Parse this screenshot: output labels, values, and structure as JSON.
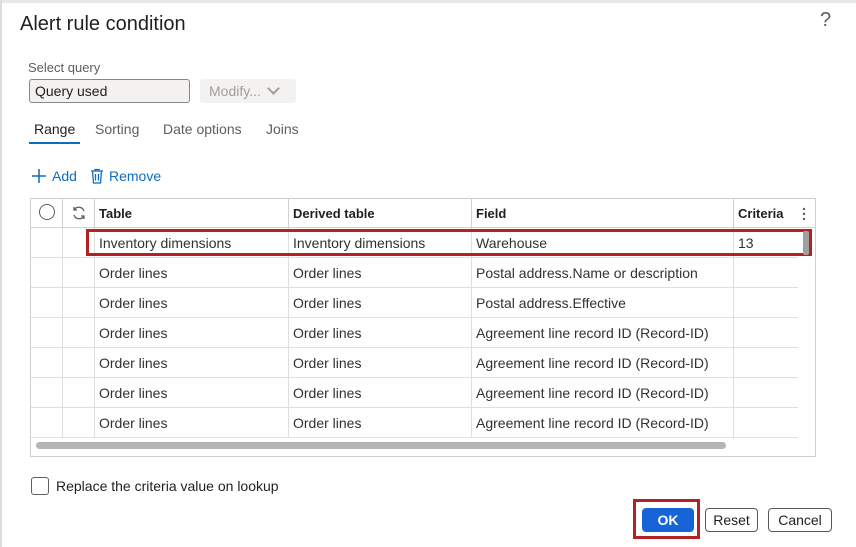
{
  "dialog": {
    "title": "Alert rule condition",
    "help_icon": "question-icon",
    "help_glyph": "?"
  },
  "query": {
    "label": "Select query",
    "value": "Query used",
    "modify_label": "Modify...",
    "modify_icon": "chevron-down-icon"
  },
  "tabs": [
    {
      "label": "Range",
      "active": true
    },
    {
      "label": "Sorting",
      "active": false
    },
    {
      "label": "Date options",
      "active": false
    },
    {
      "label": "Joins",
      "active": false
    }
  ],
  "actions": {
    "add_label": "Add",
    "add_icon": "plus-icon",
    "remove_label": "Remove",
    "remove_icon": "trash-icon"
  },
  "grid": {
    "header_icons": [
      "radio-icon",
      "refresh-icon",
      "more-vertical-icon"
    ],
    "columns": [
      "Table",
      "Derived table",
      "Field",
      "Criteria"
    ],
    "rows": [
      [
        "Inventory dimensions",
        "Inventory dimensions",
        "Warehouse",
        "13"
      ],
      [
        "Order lines",
        "Order lines",
        "Postal address.Name or description",
        ""
      ],
      [
        "Order lines",
        "Order lines",
        "Postal address.Effective",
        ""
      ],
      [
        "Order lines",
        "Order lines",
        "Agreement line record ID (Record-ID)",
        ""
      ],
      [
        "Order lines",
        "Order lines",
        "Agreement line record ID (Record-ID)",
        ""
      ],
      [
        "Order lines",
        "Order lines",
        "Agreement line record ID (Record-ID)",
        ""
      ],
      [
        "Order lines",
        "Order lines",
        "Agreement line record ID (Record-ID)",
        ""
      ]
    ],
    "selected_row": 0
  },
  "options": {
    "replace_label": "Replace the criteria value on lookup",
    "replace_checked": false
  },
  "buttons": {
    "ok": "OK",
    "reset": "Reset",
    "cancel": "Cancel"
  },
  "colors": {
    "accent": "#1664d8",
    "link": "#0f6cbd",
    "highlight": "#b22222"
  }
}
